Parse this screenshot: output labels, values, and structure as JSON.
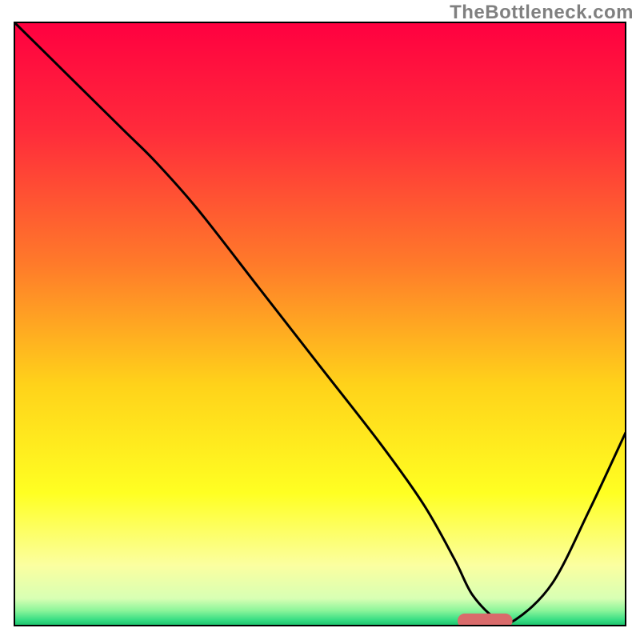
{
  "watermark": "TheBottleneck.com",
  "chart_data": {
    "type": "line",
    "title": "",
    "xlabel": "",
    "ylabel": "",
    "xlim": [
      0,
      100
    ],
    "ylim": [
      0,
      100
    ],
    "axes_visible": false,
    "grid": false,
    "background": {
      "type": "vertical-gradient",
      "stops": [
        {
          "pos": 0.0,
          "color": "#ff0040"
        },
        {
          "pos": 0.18,
          "color": "#ff2b3b"
        },
        {
          "pos": 0.4,
          "color": "#ff7a2a"
        },
        {
          "pos": 0.6,
          "color": "#ffd21a"
        },
        {
          "pos": 0.78,
          "color": "#ffff22"
        },
        {
          "pos": 0.9,
          "color": "#fbffa0"
        },
        {
          "pos": 0.955,
          "color": "#d8ffb4"
        },
        {
          "pos": 0.975,
          "color": "#8cf59a"
        },
        {
          "pos": 0.99,
          "color": "#3ade84"
        },
        {
          "pos": 1.0,
          "color": "#18c06a"
        }
      ]
    },
    "series": [
      {
        "name": "bottleneck-curve",
        "color": "#000000",
        "stroke_width": 3,
        "x": [
          0,
          8,
          18,
          23,
          30,
          40,
          50,
          60,
          67,
          72,
          75,
          79,
          82,
          88,
          94,
          100
        ],
        "y": [
          100,
          92,
          82,
          77,
          69,
          56,
          43,
          30,
          20,
          11,
          5,
          1,
          1,
          7,
          19,
          32
        ]
      }
    ],
    "marker": {
      "name": "current-pairing-marker",
      "color": "#d96b6b",
      "x_center": 77,
      "y": 0.8,
      "width": 9,
      "height": 2.4,
      "rx": 1.2
    }
  }
}
